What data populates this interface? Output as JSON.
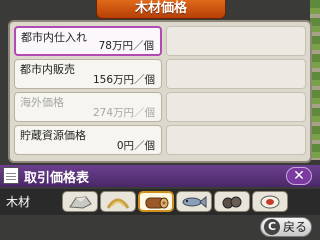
{
  "header": {
    "title": "木材価格"
  },
  "rows": [
    {
      "label": "都市内仕入れ",
      "value": "78万円／個",
      "selected": true
    },
    {
      "label": "都市内販売",
      "value": "156万円／個"
    },
    {
      "label": "海外価格",
      "value": "274万円／個",
      "disabled": true
    },
    {
      "label": "貯蔵資源価格",
      "value": "0円／個"
    }
  ],
  "titlebar": {
    "title": "取引価格表",
    "close_icon": "close-x-icon"
  },
  "category": {
    "label": "木材"
  },
  "tabs": [
    {
      "icon": "stone-icon"
    },
    {
      "icon": "grain-icon"
    },
    {
      "icon": "wood-log-icon",
      "active": true
    },
    {
      "icon": "fish-icon"
    },
    {
      "icon": "ore-icon"
    },
    {
      "icon": "food-icon"
    }
  ],
  "back_button": {
    "label": "戻る",
    "icon": "c-button-icon",
    "glyph": "C"
  }
}
